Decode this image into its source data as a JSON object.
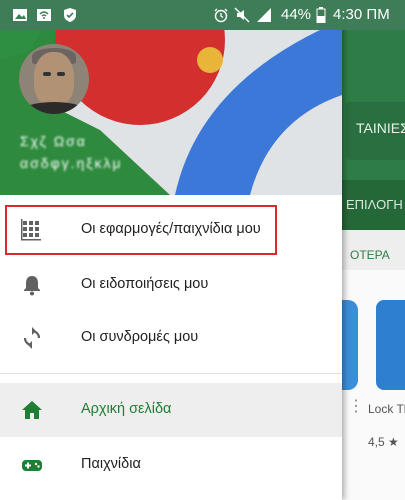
{
  "status_bar": {
    "battery": "44%",
    "time": "4:30 ΠΜ",
    "icons": [
      "image-icon",
      "wifi-icon",
      "shield-icon",
      "alarm-icon",
      "mute-icon",
      "signal-icon",
      "battery-icon"
    ]
  },
  "drawer": {
    "account": {
      "name": "Σχζ Ωσα",
      "email": "ασδφγ.ηξκλμ"
    },
    "menu": [
      {
        "label": "Οι εφαρμογές/παιχνίδια μου",
        "icon": "apps-grid-icon"
      },
      {
        "label": "Οι ειδοποιήσεις μου",
        "icon": "bell-icon"
      },
      {
        "label": "Οι συνδρομές μου",
        "icon": "refresh-icon"
      },
      {
        "label": "Αρχική σελίδα",
        "icon": "home-icon"
      },
      {
        "label": "Παιχνίδια",
        "icon": "gamepad-icon"
      }
    ]
  },
  "background_app": {
    "chip": "ΤΑΙΝΙΕΣ",
    "tab": "ΕΠΙΛΟΓΗ Σ",
    "section": "ΟΤΕΡΑ",
    "card_title": "Lock Thief",
    "card_rating": "4,5 ★"
  },
  "colors": {
    "accent_green": "#1e7e34",
    "highlight_red": "#e0272f",
    "header_green": "#2e8b3e",
    "header_red": "#d32f2f",
    "header_blue": "#3c78d8"
  }
}
